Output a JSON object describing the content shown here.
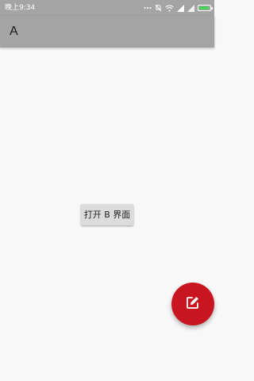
{
  "status_bar": {
    "time": "晚上9:34",
    "icons": [
      "dots-icon",
      "muted-icon",
      "wifi-icon",
      "signal-icon",
      "signal-icon",
      "battery-icon"
    ],
    "battery_color": "#49d15a"
  },
  "app_bar": {
    "title": "A",
    "background": "#a4a4a4"
  },
  "main": {
    "open_b_button_label": "打开 B 界面"
  },
  "fab": {
    "icon": "edit-icon",
    "color": "#c8151f"
  }
}
